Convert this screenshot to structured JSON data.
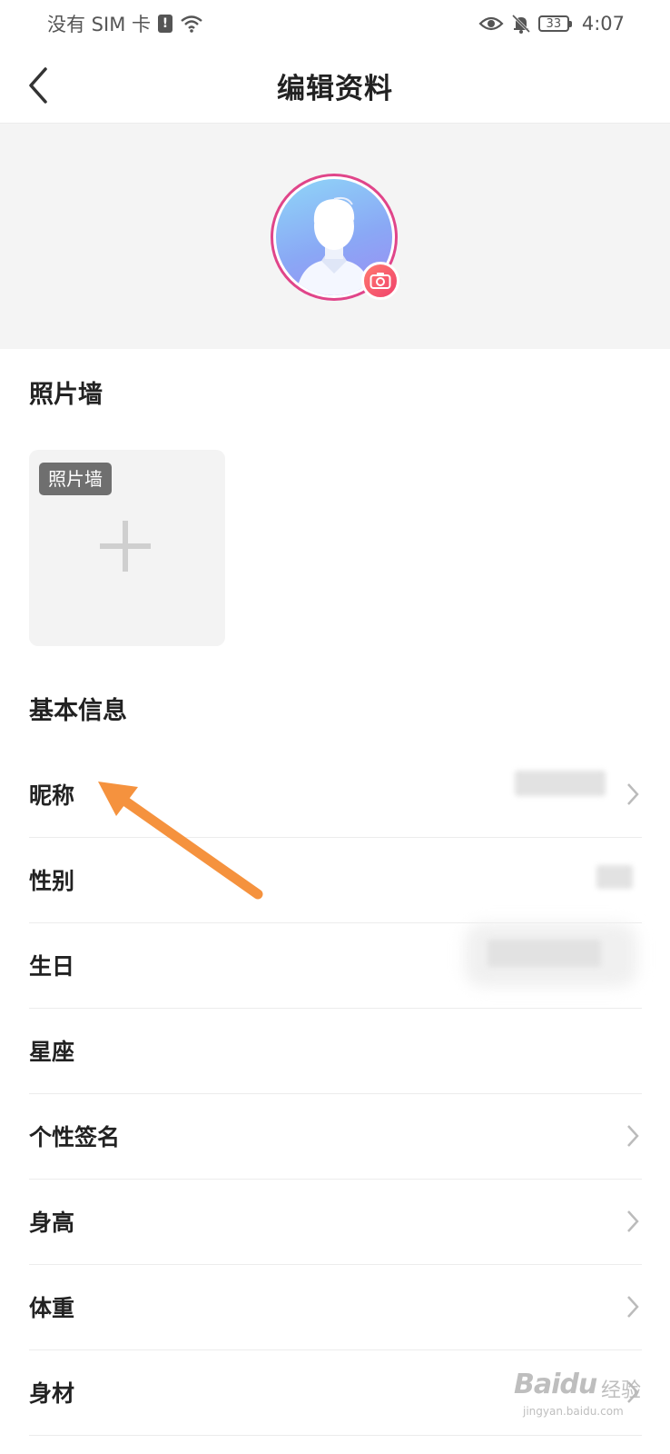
{
  "status_bar": {
    "carrier": "没有 SIM 卡",
    "sim_alert": "!",
    "battery_level": "33",
    "time": "4:07",
    "icons": [
      "wifi-icon",
      "eye-icon",
      "bell-muted-icon",
      "battery-icon"
    ]
  },
  "nav": {
    "title": "编辑资料",
    "back_icon": "chevron-left-icon"
  },
  "avatar": {
    "camera_icon": "camera-icon"
  },
  "photo_wall": {
    "section_title": "照片墙",
    "slot_tag": "照片墙",
    "add_icon": "plus-icon"
  },
  "basic_info": {
    "section_title": "基本信息",
    "rows": [
      {
        "label": "昵称",
        "has_chevron": true
      },
      {
        "label": "性别",
        "has_chevron": false
      },
      {
        "label": "生日",
        "has_chevron": false
      },
      {
        "label": "星座",
        "has_chevron": false
      },
      {
        "label": "个性签名",
        "has_chevron": true
      },
      {
        "label": "身高",
        "has_chevron": true
      },
      {
        "label": "体重",
        "has_chevron": true
      },
      {
        "label": "身材",
        "has_chevron": true
      }
    ]
  },
  "annotation": {
    "arrow_color": "#f5923e"
  },
  "watermark": {
    "brand": "Baidu",
    "brand_cn": "经验",
    "url": "jingyan.baidu.com"
  },
  "colors": {
    "accent": "#e0458a",
    "camera_badge": "#f0426d",
    "divider": "#ececec",
    "header_bg": "#f4f4f4"
  }
}
